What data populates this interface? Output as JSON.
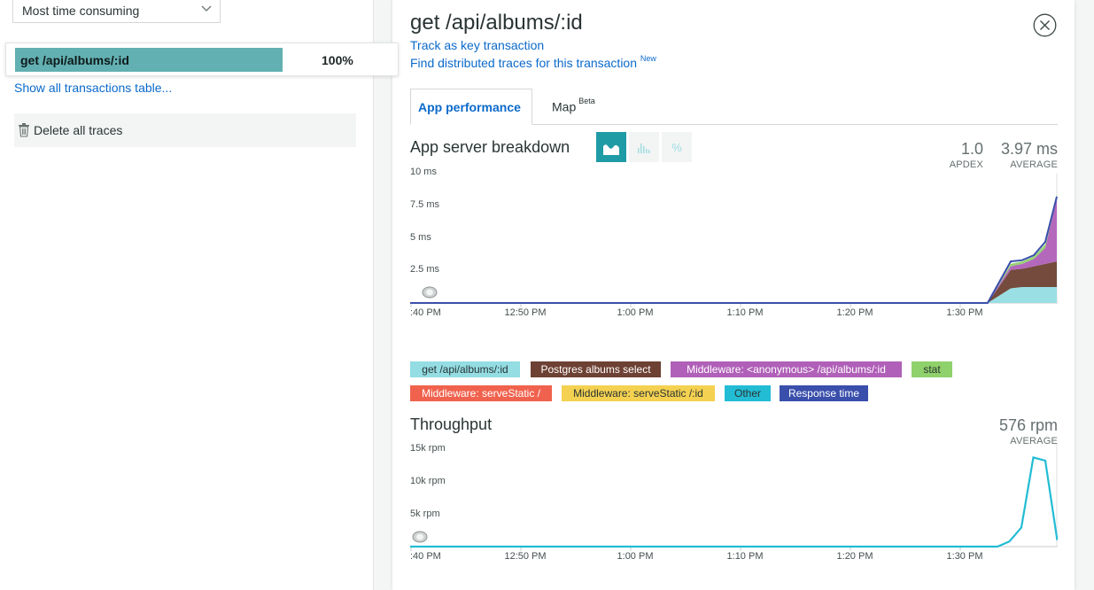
{
  "left": {
    "sort_select": "Most time consuming",
    "transaction": {
      "name": "get /api/albums/:id",
      "percent": "100%"
    },
    "show_all_link": "Show all transactions table...",
    "delete_traces": "Delete all traces"
  },
  "detail": {
    "title": "get /api/albums/:id",
    "track_link": "Track as key transaction",
    "traces_link": "Find distributed traces for this transaction",
    "traces_badge": "New",
    "tabs": [
      {
        "label": "App performance"
      },
      {
        "label": "Map",
        "badge": "Beta"
      }
    ],
    "breakdown": {
      "title": "App server breakdown",
      "apdex_value": "1.0",
      "apdex_label": "APDEX",
      "avg_value": "3.97 ms",
      "avg_label": "AVERAGE",
      "view_buttons": [
        "area-chart-icon",
        "bar-chart-icon",
        "percent-icon"
      ],
      "y_ticks": [
        "10 ms",
        "7.5 ms",
        "5 ms",
        "2.5 ms"
      ],
      "x_ticks": [
        ":40 PM",
        "12:50 PM",
        "1:00 PM",
        "1:10 PM",
        "1:20 PM",
        "1:30 PM"
      ]
    },
    "legend": [
      {
        "label": "get /api/albums/:id",
        "color": "#93dde3",
        "text_color": "#2a3434"
      },
      {
        "label": "Postgres albums select",
        "color": "#6d4133",
        "text_color": "#ffffff"
      },
      {
        "label": "Middleware: <anonymous> /api/albums/:id",
        "color": "#b060b8",
        "text_color": "#ffffff"
      },
      {
        "label": "stat",
        "color": "#8fd16a",
        "text_color": "#2a3434"
      },
      {
        "label": "Middleware: serveStatic /",
        "color": "#f0624d",
        "text_color": "#ffffff"
      },
      {
        "label": "Middleware: serveStatic /:id",
        "color": "#f4d150",
        "text_color": "#2a3434"
      },
      {
        "label": "Other",
        "color": "#22bcd4",
        "text_color": "#2a3434"
      },
      {
        "label": "Response time",
        "color": "#3a4fab",
        "text_color": "#ffffff"
      }
    ],
    "throughput": {
      "title": "Throughput",
      "avg_value": "576 rpm",
      "avg_label": "AVERAGE",
      "y_ticks": [
        "15k rpm",
        "10k rpm",
        "5k rpm"
      ],
      "x_ticks": [
        ":40 PM",
        "12:50 PM",
        "1:00 PM",
        "1:10 PM",
        "1:20 PM",
        "1:30 PM"
      ]
    }
  },
  "chart_data": [
    {
      "type": "area",
      "title": "App server breakdown",
      "ylabel": "ms",
      "ylim": [
        0,
        10
      ],
      "x": [
        "12:40 PM",
        "12:50 PM",
        "1:00 PM",
        "1:10 PM",
        "1:20 PM",
        "1:30 PM",
        "1:33 PM",
        "1:35 PM",
        "1:36 PM",
        "1:37 PM",
        "1:38 PM",
        "1:39 PM"
      ],
      "series": [
        {
          "name": "get /api/albums/:id",
          "values": [
            0,
            0,
            0,
            0,
            0,
            0,
            0,
            1.2,
            1.3,
            1.3,
            1.3,
            1.3
          ]
        },
        {
          "name": "Postgres albums select",
          "values": [
            0,
            0,
            0,
            0,
            0,
            0,
            0,
            1.5,
            1.5,
            1.7,
            1.9,
            2.1
          ]
        },
        {
          "name": "Middleware: <anonymous> /api/albums/:id",
          "values": [
            0,
            0,
            0,
            0,
            0,
            0,
            0,
            0.3,
            0.4,
            0.6,
            1.3,
            5.2
          ]
        },
        {
          "name": "stat",
          "values": [
            0,
            0,
            0,
            0,
            0,
            0,
            0,
            0.2,
            0.2,
            0.2,
            0.3,
            0.3
          ]
        },
        {
          "name": "Response time",
          "values": [
            0,
            0,
            0,
            0,
            0,
            0,
            0,
            3.4,
            3.5,
            3.9,
            5.0,
            8.7
          ]
        }
      ]
    },
    {
      "type": "line",
      "title": "Throughput",
      "ylabel": "rpm",
      "ylim": [
        0,
        15000
      ],
      "x": [
        "12:40 PM",
        "12:50 PM",
        "1:00 PM",
        "1:10 PM",
        "1:20 PM",
        "1:30 PM",
        "1:34 PM",
        "1:35 PM",
        "1:36 PM",
        "1:37 PM",
        "1:38 PM",
        "1:39 PM"
      ],
      "series": [
        {
          "name": "Throughput",
          "values": [
            0,
            0,
            0,
            0,
            0,
            0,
            0,
            800,
            3000,
            14000,
            13500,
            1000
          ]
        }
      ]
    }
  ]
}
